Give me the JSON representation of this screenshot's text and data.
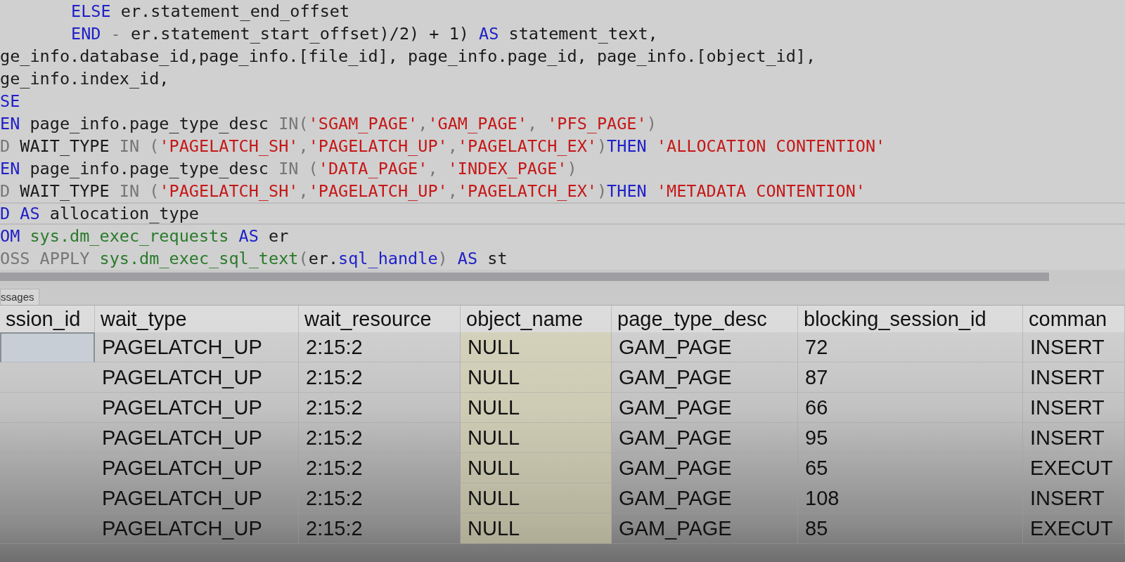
{
  "editor": {
    "lines": [
      {
        "indented": true,
        "current": false,
        "tokens": [
          {
            "t": "ELSE",
            "kind": "keyword"
          },
          {
            "t": " er.statement_end_offset",
            "kind": "plain"
          }
        ]
      },
      {
        "indented": true,
        "current": false,
        "tokens": [
          {
            "t": "END",
            "kind": "keyword"
          },
          {
            "t": " - ",
            "kind": "operator"
          },
          {
            "t": "er.statement_start_offset)/2) + 1) ",
            "kind": "plain"
          },
          {
            "t": "AS",
            "kind": "keyword"
          },
          {
            "t": " statement_text,",
            "kind": "plain"
          }
        ]
      },
      {
        "indented": false,
        "current": false,
        "tokens": [
          {
            "t": "ge_info.database_id,page_info.[file_id], page_info.page_id, page_info.[object_id],",
            "kind": "plain"
          }
        ]
      },
      {
        "indented": false,
        "current": false,
        "tokens": [
          {
            "t": "ge_info.index_id,",
            "kind": "plain"
          }
        ]
      },
      {
        "indented": false,
        "current": false,
        "tokens": [
          {
            "t": "SE",
            "kind": "keyword"
          }
        ]
      },
      {
        "indented": false,
        "current": false,
        "tokens": [
          {
            "t": "EN",
            "kind": "keyword"
          },
          {
            "t": " page_info.page_type_desc ",
            "kind": "plain"
          },
          {
            "t": "IN(",
            "kind": "operator"
          },
          {
            "t": "'SGAM_PAGE'",
            "kind": "string"
          },
          {
            "t": ",",
            "kind": "operator"
          },
          {
            "t": "'GAM_PAGE'",
            "kind": "string"
          },
          {
            "t": ", ",
            "kind": "operator"
          },
          {
            "t": "'PFS_PAGE'",
            "kind": "string"
          },
          {
            "t": ")",
            "kind": "operator"
          }
        ]
      },
      {
        "indented": false,
        "current": false,
        "tokens": [
          {
            "t": "D",
            "kind": "operator"
          },
          {
            "t": " WAIT_TYPE ",
            "kind": "plain"
          },
          {
            "t": "IN (",
            "kind": "operator"
          },
          {
            "t": "'PAGELATCH_SH'",
            "kind": "string"
          },
          {
            "t": ",",
            "kind": "operator"
          },
          {
            "t": "'PAGELATCH_UP'",
            "kind": "string"
          },
          {
            "t": ",",
            "kind": "operator"
          },
          {
            "t": "'PAGELATCH_EX'",
            "kind": "string"
          },
          {
            "t": ")",
            "kind": "operator"
          },
          {
            "t": "THEN",
            "kind": "keyword"
          },
          {
            "t": " 'ALLOCATION CONTENTION'",
            "kind": "string"
          }
        ]
      },
      {
        "indented": false,
        "current": false,
        "tokens": [
          {
            "t": "EN",
            "kind": "keyword"
          },
          {
            "t": " page_info.page_type_desc ",
            "kind": "plain"
          },
          {
            "t": "IN (",
            "kind": "operator"
          },
          {
            "t": "'DATA_PAGE'",
            "kind": "string"
          },
          {
            "t": ", ",
            "kind": "operator"
          },
          {
            "t": "'INDEX_PAGE'",
            "kind": "string"
          },
          {
            "t": ")",
            "kind": "operator"
          }
        ]
      },
      {
        "indented": false,
        "current": false,
        "tokens": [
          {
            "t": "D",
            "kind": "operator"
          },
          {
            "t": " WAIT_TYPE ",
            "kind": "plain"
          },
          {
            "t": "IN (",
            "kind": "operator"
          },
          {
            "t": "'PAGELATCH_SH'",
            "kind": "string"
          },
          {
            "t": ",",
            "kind": "operator"
          },
          {
            "t": "'PAGELATCH_UP'",
            "kind": "string"
          },
          {
            "t": ",",
            "kind": "operator"
          },
          {
            "t": "'PAGELATCH_EX'",
            "kind": "string"
          },
          {
            "t": ")",
            "kind": "operator"
          },
          {
            "t": "THEN",
            "kind": "keyword"
          },
          {
            "t": " 'METADATA CONTENTION'",
            "kind": "string"
          }
        ]
      },
      {
        "indented": false,
        "current": true,
        "tokens": [
          {
            "t": "D AS",
            "kind": "keyword"
          },
          {
            "t": " allocation_type",
            "kind": "plain"
          }
        ]
      },
      {
        "indented": false,
        "current": false,
        "tokens": [
          {
            "t": "OM",
            "kind": "keyword"
          },
          {
            "t": " sys.dm_exec_requests",
            "kind": "function"
          },
          {
            "t": " AS",
            "kind": "keyword"
          },
          {
            "t": " er",
            "kind": "plain"
          }
        ]
      },
      {
        "indented": false,
        "current": false,
        "tokens": [
          {
            "t": "OSS APPLY",
            "kind": "operator"
          },
          {
            "t": " sys.dm_exec_sql_text",
            "kind": "function"
          },
          {
            "t": "(",
            "kind": "operator"
          },
          {
            "t": "er.",
            "kind": "plain"
          },
          {
            "t": "sql_handle",
            "kind": "keyword"
          },
          {
            "t": ")",
            "kind": "operator"
          },
          {
            "t": " AS",
            "kind": "keyword"
          },
          {
            "t": " st",
            "kind": "plain"
          }
        ]
      }
    ]
  },
  "results_tab": {
    "label": "ssages"
  },
  "grid": {
    "columns": [
      "ssion_id",
      "wait_type",
      "wait_resource",
      "object_name",
      "page_type_desc",
      "blocking_session_id",
      "comman"
    ],
    "rows": [
      {
        "selected": true,
        "cells": [
          "",
          "PAGELATCH_UP",
          "2:15:2",
          "NULL",
          "GAM_PAGE",
          "72",
          "INSERT"
        ]
      },
      {
        "selected": false,
        "cells": [
          "",
          "PAGELATCH_UP",
          "2:15:2",
          "NULL",
          "GAM_PAGE",
          "87",
          "INSERT"
        ]
      },
      {
        "selected": false,
        "cells": [
          "",
          "PAGELATCH_UP",
          "2:15:2",
          "NULL",
          "GAM_PAGE",
          "66",
          "INSERT"
        ]
      },
      {
        "selected": false,
        "cells": [
          "",
          "PAGELATCH_UP",
          "2:15:2",
          "NULL",
          "GAM_PAGE",
          "95",
          "INSERT"
        ]
      },
      {
        "selected": false,
        "cells": [
          "",
          "PAGELATCH_UP",
          "2:15:2",
          "NULL",
          "GAM_PAGE",
          "65",
          "EXECUT"
        ]
      },
      {
        "selected": false,
        "cells": [
          "",
          "PAGELATCH_UP",
          "2:15:2",
          "NULL",
          "GAM_PAGE",
          "108",
          "INSERT"
        ]
      },
      {
        "selected": false,
        "cells": [
          "",
          "PAGELATCH_UP",
          "2:15:2",
          "NULL",
          "GAM_PAGE",
          "85",
          "EXECUT"
        ]
      }
    ]
  }
}
